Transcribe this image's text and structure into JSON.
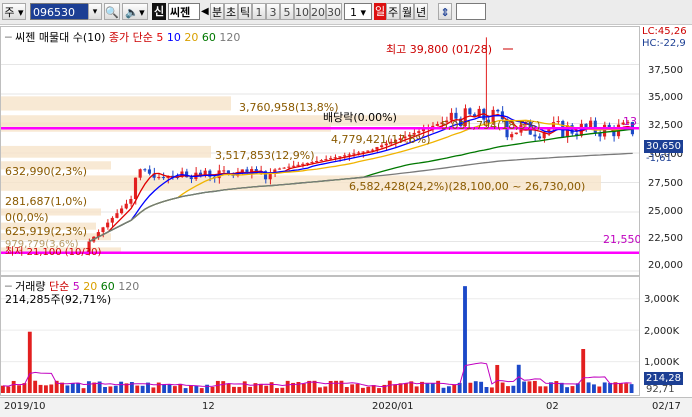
{
  "toolbar": {
    "market_label": "주",
    "code": "096530",
    "icon_search": "search-icon",
    "icon_sound": "speaker-icon",
    "tag_credit": "신",
    "stock_name": "씨젠",
    "period_prefix": "◀",
    "period_unit": "분",
    "period_tick": "초",
    "tick_label": "틱",
    "minute_buttons": [
      "1",
      "3",
      "5",
      "10",
      "20",
      "30"
    ],
    "count_value": "1",
    "period_day": "일",
    "period_week": "주",
    "period_month": "월",
    "period_year": "년",
    "arrow_icon": "updown-arrow-icon"
  },
  "price_panel": {
    "title": "씨젠 매물대 수(10)",
    "ma_label": "종가 단순",
    "ma_values": [
      "5",
      "10",
      "20",
      "60",
      "120"
    ],
    "ma_colors": [
      "#e00000",
      "#0000ff",
      "#f0b400",
      "#007800",
      "#7a7a7a"
    ],
    "lc_label": "LC:45,26",
    "hc_label": "HC:-22,9",
    "max_label": "최고 39,800 (01/28)",
    "min_label": "최저 21,100 (10/30)",
    "current_price": "30,650",
    "current_change": "-1,61",
    "line_13": "13",
    "support_value": "21,550",
    "dividend_label": "배당락(0.00%)",
    "y_ticks": [
      "37,500",
      "35,000",
      "32,500",
      "30,000",
      "27,500",
      "25,000",
      "22,500",
      "20,000"
    ],
    "volume_profile": [
      {
        "text": "3,760,958(13,8%)"
      },
      {
        "text": "4,779,421(17,6%)"
      },
      {
        "text": "5,031,794(18,5%)"
      },
      {
        "text": "3,517,853(12,9%)"
      },
      {
        "text": "632,990(2,3%)"
      },
      {
        "text": "6,582,428(24,2%)(28,100,00 ~ 26,730,00)"
      },
      {
        "text": "281,687(1,0%)"
      },
      {
        "text": "0(0,0%)"
      },
      {
        "text": "625,919(2,3%)"
      },
      {
        "text": "979,?79(3,6%)"
      }
    ]
  },
  "volume_panel": {
    "title": "거래량",
    "ma_label": "단순",
    "ma_values": [
      "5",
      "20",
      "60",
      "120"
    ],
    "value_label": "214,285주(92,71%)",
    "y_ticks": [
      "3,000K",
      "2,000K",
      "1,000K"
    ],
    "tag_current": "214,28",
    "tag_pct": "92,71"
  },
  "x_axis": {
    "labels": [
      "2019/10",
      "12",
      "2020/01",
      "02",
      "02/17"
    ]
  },
  "chart_data": {
    "type": "candlestick",
    "title": "씨젠 매물대 수(10)",
    "ylim": [
      20000,
      40000
    ],
    "price_high": 39800,
    "price_low": 21100,
    "current": 30650,
    "horizontal_lines": [
      32100,
      21550
    ],
    "volume_ylim": [
      0,
      3500000
    ]
  }
}
